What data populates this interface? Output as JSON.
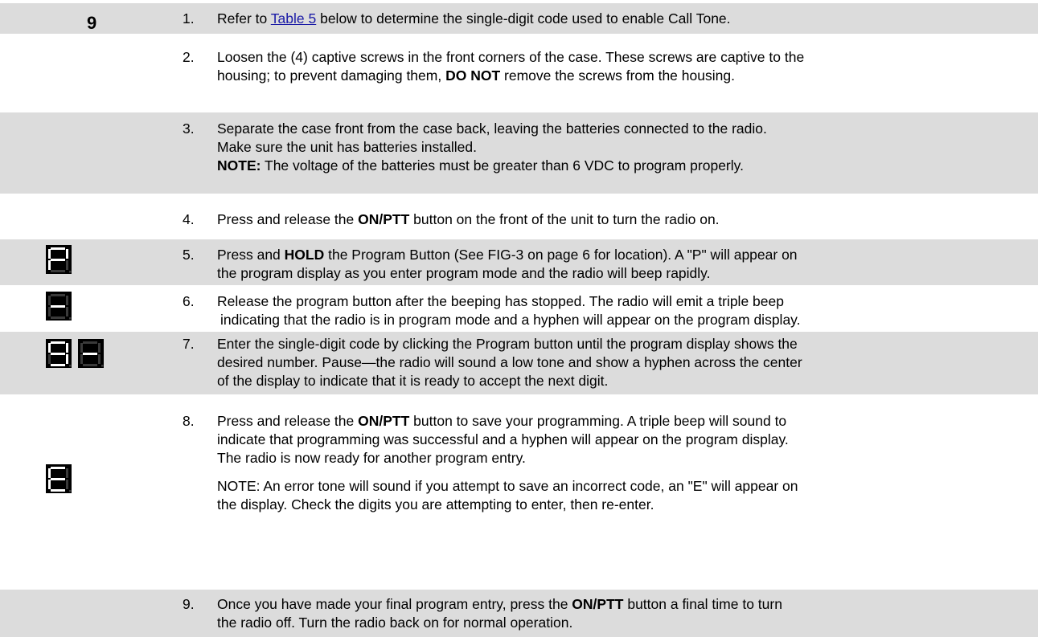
{
  "step_label": "9",
  "steps": [
    {
      "num": "1.",
      "pre": "Refer to ",
      "link": "Table 5",
      "post": " below to determine the single-digit code used to enable Call Tone."
    },
    {
      "num": "2.",
      "lines": [
        "Loosen the (4) captive screws in the front corners of the case. These screws are captive to the",
        "housing; to prevent damaging them, "
      ],
      "bold": "DO NOT",
      "post": " remove the screws from the housing."
    },
    {
      "num": "3.",
      "lines": [
        "Separate the case front from the case back, leaving the batteries connected to the radio.",
        "Make sure the unit has batteries installed."
      ],
      "note_bold": "NOTE:",
      "note": "  The voltage of the batteries must be greater than 6 VDC to program properly."
    },
    {
      "num": "4.",
      "pre": "Press and release the ",
      "bold": "ON/PTT",
      "post": " button on the front of the unit to turn the radio on."
    },
    {
      "num": "5.",
      "pre": "Press and ",
      "bold": "HOLD",
      "post": " the Program Button (See FIG-3 on page 6 for location).  A \"P\" will appear on",
      "line2": "the program display as you enter program mode and the radio will beep rapidly."
    },
    {
      "num": "6.",
      "line1": "Release the program button after the beeping has stopped. The radio will emit a triple beep",
      "line2": "indicating that the radio is in program mode and a hyphen will appear on the program display."
    },
    {
      "num": "7.",
      "line1": "Enter the single-digit code by clicking the Program button until the program display shows the",
      "line2": "desired number. Pause—the radio will sound a low tone and show a hyphen across the center",
      "line3": "of the display to indicate that it is ready to accept the next digit."
    },
    {
      "num": "8.",
      "pre": "Press and release the ",
      "bold": "ON/PTT",
      "post": " button to save your programming. A triple beep will sound to",
      "line2": "indicate that programming was successful and a hyphen will appear on the program display.",
      "line3": "The radio is now ready for another program entry.",
      "note1": "NOTE:  An error tone will sound if you attempt to save an incorrect code, an \"E\" will appear on",
      "note2": "the display.  Check the digits you are attempting to enter, then re-enter."
    },
    {
      "num": "9.",
      "pre": "Once you have made your final program entry, press the ",
      "bold": "ON/PTT",
      "post": " button a final time to turn",
      "line2": "the radio off.  Turn the radio back on for normal operation."
    }
  ],
  "displays": {
    "step5": "P",
    "step6": "-",
    "step7a": "9",
    "step7b": "-",
    "step8": "E"
  }
}
